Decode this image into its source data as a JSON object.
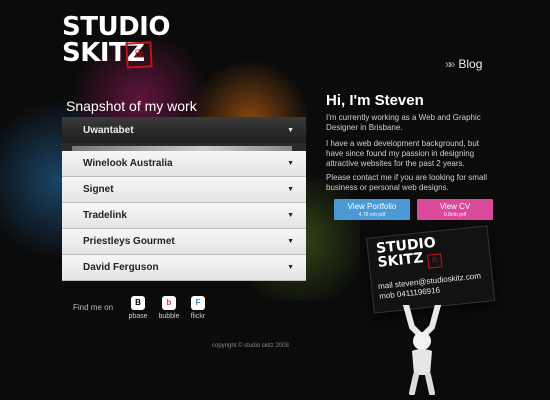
{
  "brand": {
    "line1": "STUDIO",
    "line2": "SKITZ",
    "stamp": "氏"
  },
  "nav": {
    "blog_label": "Blog",
    "blog_arrow": "»»"
  },
  "portfolio": {
    "title": "Snapshot of my work",
    "items": [
      {
        "label": "Uwantabet",
        "active": true
      },
      {
        "label": "Winelook Australia"
      },
      {
        "label": "Signet"
      },
      {
        "label": "Tradelink"
      },
      {
        "label": "Priestleys Gourmet"
      },
      {
        "label": "David Ferguson"
      }
    ]
  },
  "social": {
    "find_label": "Find me on",
    "links": [
      {
        "label": "pbase",
        "glyph": "B",
        "color": "#ffffff"
      },
      {
        "label": "bubble",
        "glyph": "b",
        "color": "#e0306a"
      },
      {
        "label": "flickr",
        "glyph": "F",
        "color": "#2a8ad0"
      }
    ]
  },
  "copyright": "copyright © studio skitz 2008",
  "intro": {
    "greeting": "Hi, I'm Steven",
    "para1": "I'm currently working as a Web and Graphic Designer in Brisbane.",
    "para2": "I have a web development background, but have since found my passion in designing attractive websites for the past 2 years.",
    "para3": "Please contact me if you are looking for small business or personal web designs."
  },
  "buttons": {
    "portfolio_label": "View Portfolio",
    "portfolio_size": "4.78 mb pdf",
    "portfolio_color": "#4a9ad6",
    "cv_label": "View CV",
    "cv_size": "0.8mb pdf",
    "cv_color": "#d94a9a"
  },
  "card": {
    "logo1": "STUDIO",
    "logo2": "SKITZ",
    "mail": "mail steven@studioskitz.com",
    "mob": "mob 0411196916"
  },
  "icons": {
    "dropdown": "▼"
  }
}
